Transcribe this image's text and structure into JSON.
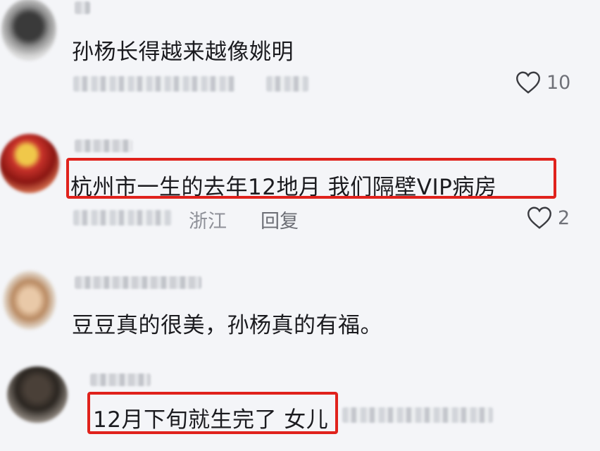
{
  "comments": [
    {
      "text": "孙杨长得越来越像姚明",
      "likes": "10"
    },
    {
      "text": "杭州市一生的去年12地月 我们隔壁VIP病房",
      "location": "浙江",
      "reply": "回复",
      "likes": "2"
    },
    {
      "text": "豆豆真的很美，孙杨真的有福。"
    },
    {
      "text": "12月下旬就生完了 女儿"
    }
  ],
  "colors": {
    "highlight": "#e0221c",
    "background": "#f4f5f8"
  },
  "icons": [
    "heart-outline-icon"
  ]
}
